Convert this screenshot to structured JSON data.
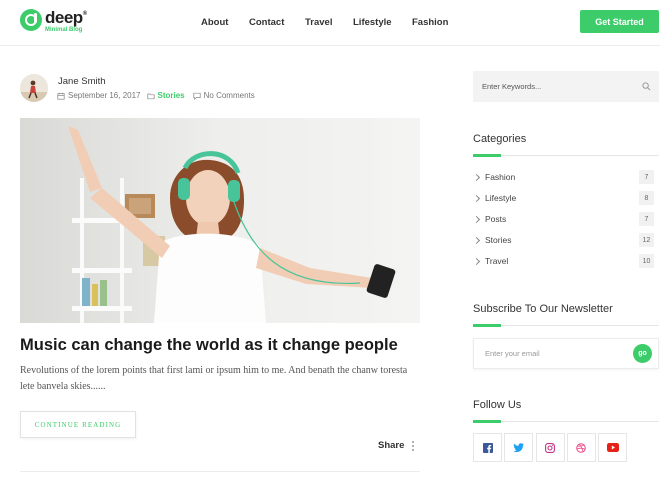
{
  "brand": {
    "name": "deep",
    "trademark": "®",
    "tagline": "Minimal Blog",
    "color": "#3ccd6a"
  },
  "nav": [
    {
      "label": "About"
    },
    {
      "label": "Contact"
    },
    {
      "label": "Travel"
    },
    {
      "label": "Lifestyle"
    },
    {
      "label": "Fashion"
    }
  ],
  "header": {
    "cta_label": "Get Started"
  },
  "post": {
    "author": "Jane Smith",
    "date": "September 16, 2017",
    "category": "Stories",
    "comments": "No Comments",
    "title": "Music can change the world as it change people",
    "excerpt": "Revolutions of the lorem points that first lami or ipsum him to me. And benath the chanw toresta lete banvela skies......",
    "read_more": "CONTINUE READING",
    "share_label": "Share"
  },
  "sidebar": {
    "search_placeholder": "Enter Keywords...",
    "categories_title": "Categories",
    "categories": [
      {
        "label": "Fashion",
        "count": "7"
      },
      {
        "label": "Lifestyle",
        "count": "8"
      },
      {
        "label": "Posts",
        "count": "7"
      },
      {
        "label": "Stories",
        "count": "12"
      },
      {
        "label": "Travel",
        "count": "10"
      }
    ],
    "newsletter_title": "Subscribe To Our Newsletter",
    "newsletter_placeholder": "Enter your email",
    "newsletter_button": "go",
    "follow_title": "Follow Us",
    "socials": [
      {
        "icon": "facebook-icon",
        "color": "#3b5998"
      },
      {
        "icon": "twitter-icon",
        "color": "#1da1f2"
      },
      {
        "icon": "instagram-icon",
        "color": "#c13584"
      },
      {
        "icon": "dribbble-icon",
        "color": "#ea4c89"
      },
      {
        "icon": "youtube-icon",
        "color": "#e62117"
      }
    ]
  }
}
